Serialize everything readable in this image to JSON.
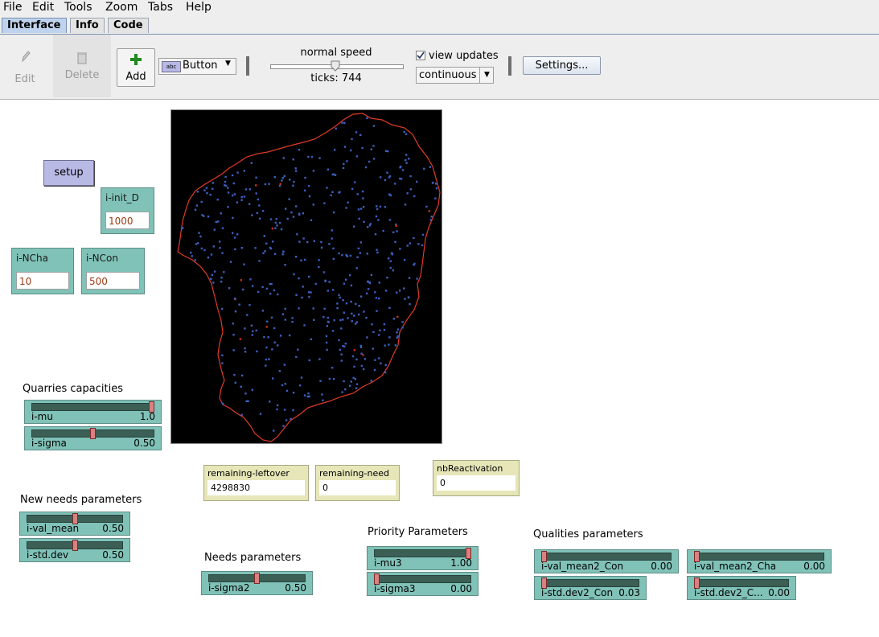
{
  "menu": [
    "File",
    "Edit",
    "Tools",
    "Zoom",
    "Tabs",
    "Help"
  ],
  "tabs": [
    "Interface",
    "Info",
    "Code"
  ],
  "toolbar": {
    "edit_label": "Edit",
    "delete_label": "Delete",
    "add_label": "Add",
    "widget_type": "Button",
    "speed_label": "normal speed",
    "ticks_text": "ticks: 744",
    "view_updates_label": "view updates",
    "view_updates_checked": true,
    "update_mode": "continuous",
    "settings_label": "Settings..."
  },
  "widgets": {
    "setup_button": "setup",
    "inputs": {
      "init_d": {
        "name": "i-init_D",
        "value": "1000"
      },
      "ncha": {
        "name": "i-NCha",
        "value": "10"
      },
      "ncon": {
        "name": "i-NCon",
        "value": "500"
      }
    },
    "groups": {
      "quarries": "Quarries capacities",
      "new_needs": "New needs parameters",
      "needs": "Needs parameters",
      "priority": "Priority Parameters",
      "qualities": "Qualities parameters"
    },
    "sliders": {
      "mu": {
        "name": "i-mu",
        "value": "1.0",
        "fraction": 1.0
      },
      "sigma": {
        "name": "i-sigma",
        "value": "0.50",
        "fraction": 0.5
      },
      "val_mean": {
        "name": "i-val_mean",
        "value": "0.50",
        "fraction": 0.5
      },
      "std_dev": {
        "name": "i-std.dev",
        "value": "0.50",
        "fraction": 0.5
      },
      "sigma2": {
        "name": "i-sigma2",
        "value": "0.50",
        "fraction": 0.5
      },
      "mu3": {
        "name": "i-mu3",
        "value": "1.00",
        "fraction": 1.0
      },
      "sigma3": {
        "name": "i-sigma3",
        "value": "0.00",
        "fraction": 0.0
      },
      "val_mean2_con": {
        "name": "i-val_mean2_Con",
        "value": "0.00",
        "fraction": 0.0
      },
      "std_dev2_con": {
        "name": "i-std.dev2_Con",
        "value": "0.03",
        "fraction": 0.0
      },
      "val_mean2_cha": {
        "name": "i-val_mean2_Cha",
        "value": "0.00",
        "fraction": 0.0
      },
      "std_dev2_cha": {
        "name": "i-std.dev2_C...",
        "value": "0.00",
        "fraction": 0.0
      }
    },
    "monitors": {
      "remaining_leftover": {
        "name": "remaining-leftover",
        "value": "4298830"
      },
      "remaining_need": {
        "name": "remaining-need",
        "value": "0"
      },
      "nb_reactivation": {
        "name": "nbReactivation",
        "value": "0"
      }
    }
  },
  "colors": {
    "view_background": "#000000",
    "boundary": "#e03a2a",
    "agents_blue": "#3c5fbf",
    "agents_red": "#d02a1a"
  }
}
